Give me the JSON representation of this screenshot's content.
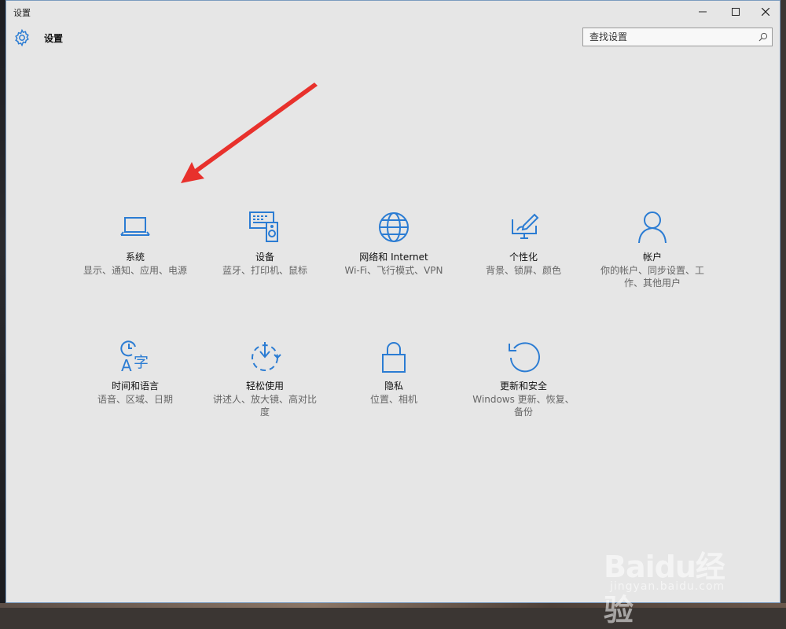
{
  "window": {
    "title": "设置",
    "controls": [
      "minimize",
      "maximize",
      "close"
    ]
  },
  "header": {
    "title": "设置",
    "icon": "gear-icon"
  },
  "search": {
    "placeholder": "查找设置",
    "icon": "search-icon"
  },
  "accent_color": "#2b7cd3",
  "annotation": {
    "type": "arrow",
    "color": "#e8312c"
  },
  "tiles": [
    {
      "label": "系统",
      "desc": "显示、通知、应用、电源",
      "icon": "laptop-icon"
    },
    {
      "label": "设备",
      "desc": "蓝牙、打印机、鼠标",
      "icon": "devices-icon"
    },
    {
      "label": "网络和 Internet",
      "desc": "Wi-Fi、飞行模式、VPN",
      "icon": "globe-icon"
    },
    {
      "label": "个性化",
      "desc": "背景、锁屏、颜色",
      "icon": "personalize-icon"
    },
    {
      "label": "帐户",
      "desc": "你的帐户、同步设置、工作、其他用户",
      "icon": "person-icon"
    },
    {
      "label": "时间和语言",
      "desc": "语音、区域、日期",
      "icon": "time-language-icon"
    },
    {
      "label": "轻松使用",
      "desc": "讲述人、放大镜、高对比度",
      "icon": "ease-of-access-icon"
    },
    {
      "label": "隐私",
      "desc": "位置、相机",
      "icon": "lock-icon"
    },
    {
      "label": "更新和安全",
      "desc": "Windows 更新、恢复、备份",
      "icon": "update-icon"
    }
  ],
  "watermark": {
    "text": "Baidu经验",
    "sub": "jingyan.baidu.com"
  }
}
